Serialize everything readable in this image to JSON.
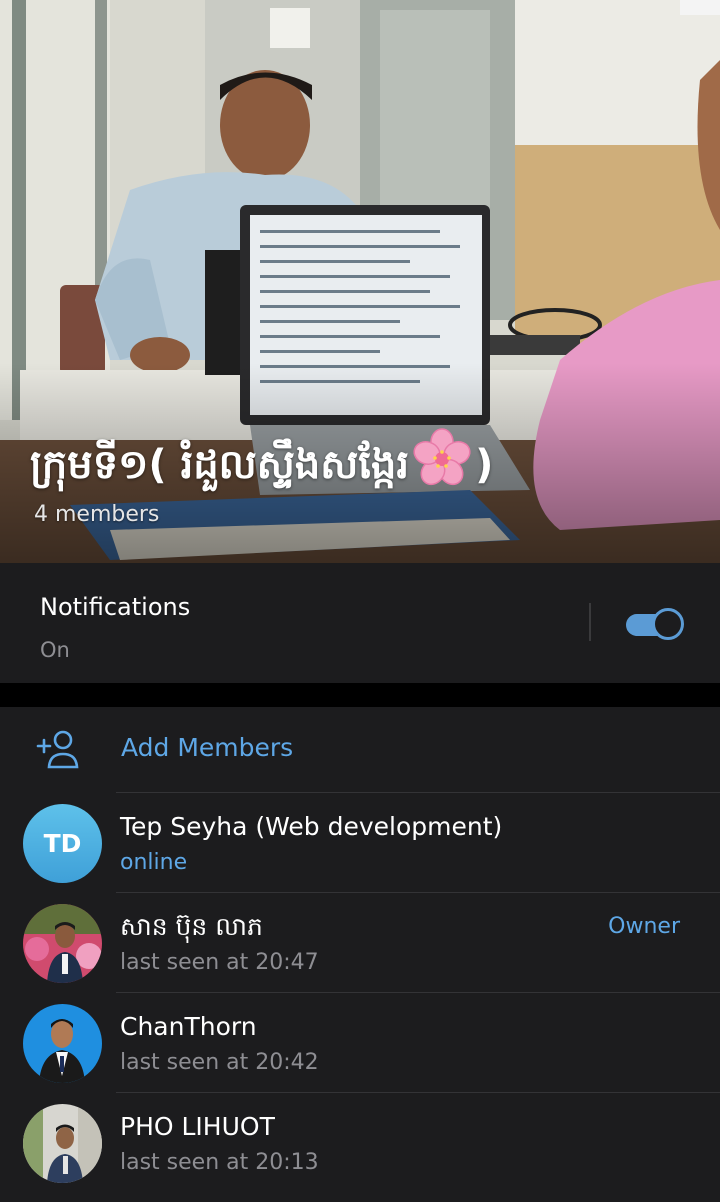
{
  "group": {
    "title_prefix": "ក្រុមទី១( រំដួលស្ទឹងសង្កែរ",
    "title_suffix": ")",
    "member_count": "4 members"
  },
  "notifications": {
    "label": "Notifications",
    "state": "On",
    "enabled": true
  },
  "add_members": {
    "label": "Add Members"
  },
  "members": [
    {
      "name": "Tep Seyha (Web development)",
      "status": "online",
      "initials": "TD",
      "role": ""
    },
    {
      "name": "សាន ប៊ុន លាភ",
      "status": "last seen at 20:47",
      "role": "Owner"
    },
    {
      "name": "ChanThorn",
      "status": "last seen at 20:42",
      "role": ""
    },
    {
      "name": "PHO LIHUOT",
      "status": "last seen at 20:13",
      "role": ""
    }
  ],
  "colors": {
    "accent": "#5ea7e6",
    "card_bg": "#1c1c1e",
    "muted_text": "#8e8e93",
    "avatar_initials_bg": "#4fb3e3"
  }
}
